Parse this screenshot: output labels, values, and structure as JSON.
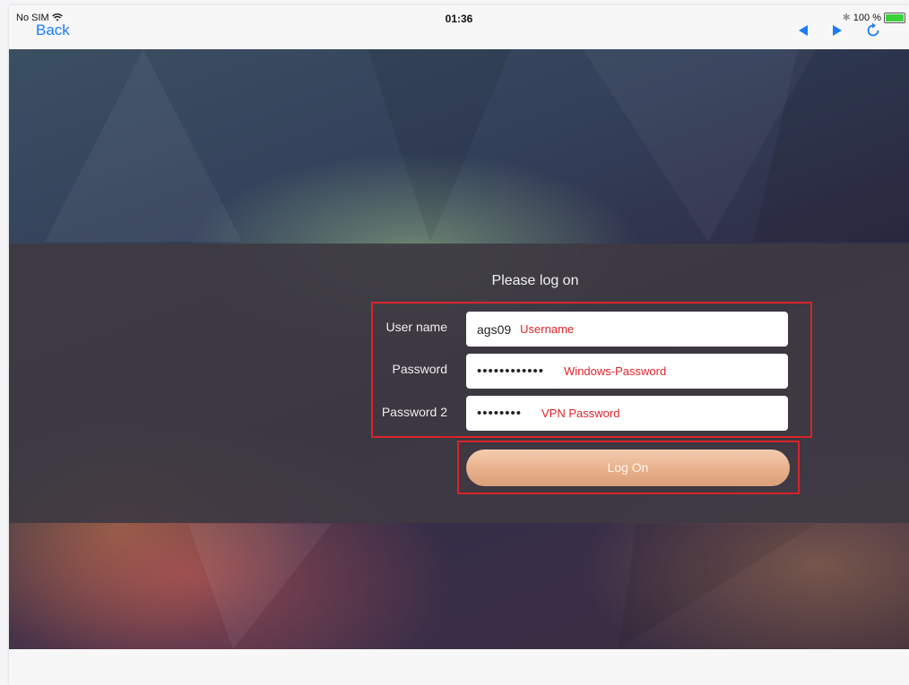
{
  "status_bar": {
    "carrier": "No SIM",
    "time": "01:36",
    "battery_percent": "100 %",
    "battery_level": 1.0
  },
  "nav": {
    "back_label": "Back",
    "icons": [
      "back-arrow-icon",
      "forward-arrow-icon",
      "refresh-icon"
    ]
  },
  "login": {
    "title": "Please log on",
    "username_label": "User name",
    "username_value": "ags09",
    "username_annotation": "Username",
    "password_label": "Password",
    "password_value": "••••••••••••",
    "password_annotation": "Windows-Password",
    "password2_label": "Password 2",
    "password2_value": "••••••••",
    "password2_annotation": "VPN Password",
    "logon_button": "Log On"
  },
  "colors": {
    "annotation_red": "#d9232b",
    "ios_blue": "#1a7cf5",
    "button_peach": "#e7b08b"
  }
}
